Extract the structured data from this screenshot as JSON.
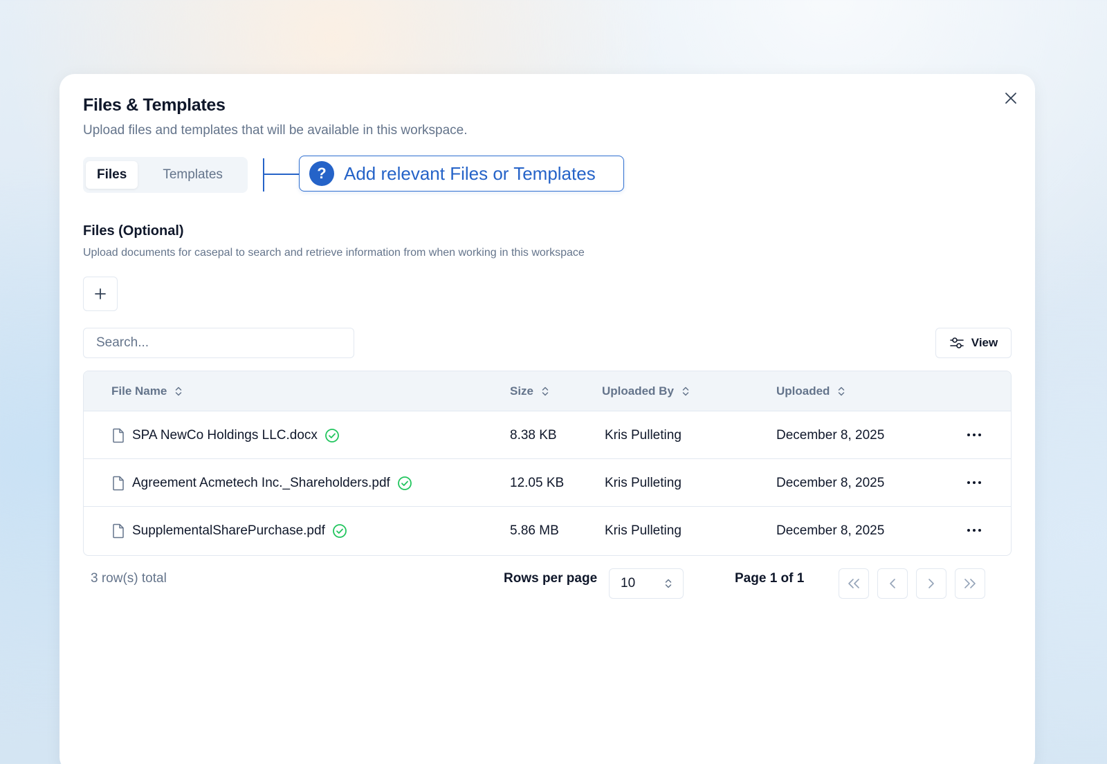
{
  "dialog": {
    "title": "Files & Templates",
    "subtitle": "Upload files and templates that will be available in this workspace."
  },
  "tabs": [
    {
      "label": "Files",
      "active": true
    },
    {
      "label": "Templates",
      "active": false
    }
  ],
  "hint": {
    "icon": "?",
    "text": "Add relevant Files or Templates"
  },
  "section": {
    "title": "Files (Optional)",
    "description": "Upload documents for casepal to search and retrieve information from when working in this workspace"
  },
  "search": {
    "placeholder": "Search...",
    "value": ""
  },
  "view_button": {
    "label": "View"
  },
  "table": {
    "columns": [
      "File Name",
      "Size",
      "Uploaded By",
      "Uploaded"
    ],
    "rows": [
      {
        "name": "SPA NewCo Holdings LLC.docx",
        "size": "8.38 KB",
        "uploaded_by": "Kris Pulleting",
        "uploaded": "December 8, 2025",
        "status": "processed"
      },
      {
        "name": "Agreement Acmetech Inc._Shareholders.pdf",
        "size": "12.05 KB",
        "uploaded_by": "Kris Pulleting",
        "uploaded": "December 8, 2025",
        "status": "processed"
      },
      {
        "name": "SupplementalSharePurchase.pdf",
        "size": "5.86 MB",
        "uploaded_by": "Kris Pulleting",
        "uploaded": "December 8, 2025",
        "status": "processed"
      }
    ]
  },
  "footer": {
    "total": "3 row(s) total",
    "rows_per_page_label": "Rows per page",
    "rows_per_page_value": "10",
    "page_info": "Page 1 of 1"
  },
  "colors": {
    "accent": "#2563c8",
    "success": "#22c55e",
    "muted_text": "#64748b"
  },
  "icons": {
    "close": "close-icon",
    "hint": "question-icon",
    "add": "plus-icon",
    "view": "sliders-icon",
    "sort": "sort-icon",
    "file": "file-icon",
    "status": "check-circle-icon",
    "more": "more-horizontal-icon",
    "select": "chevron-up-down-icon",
    "first": "chevrons-left-icon",
    "prev": "chevron-left-icon",
    "next": "chevron-right-icon",
    "last": "chevrons-right-icon"
  }
}
